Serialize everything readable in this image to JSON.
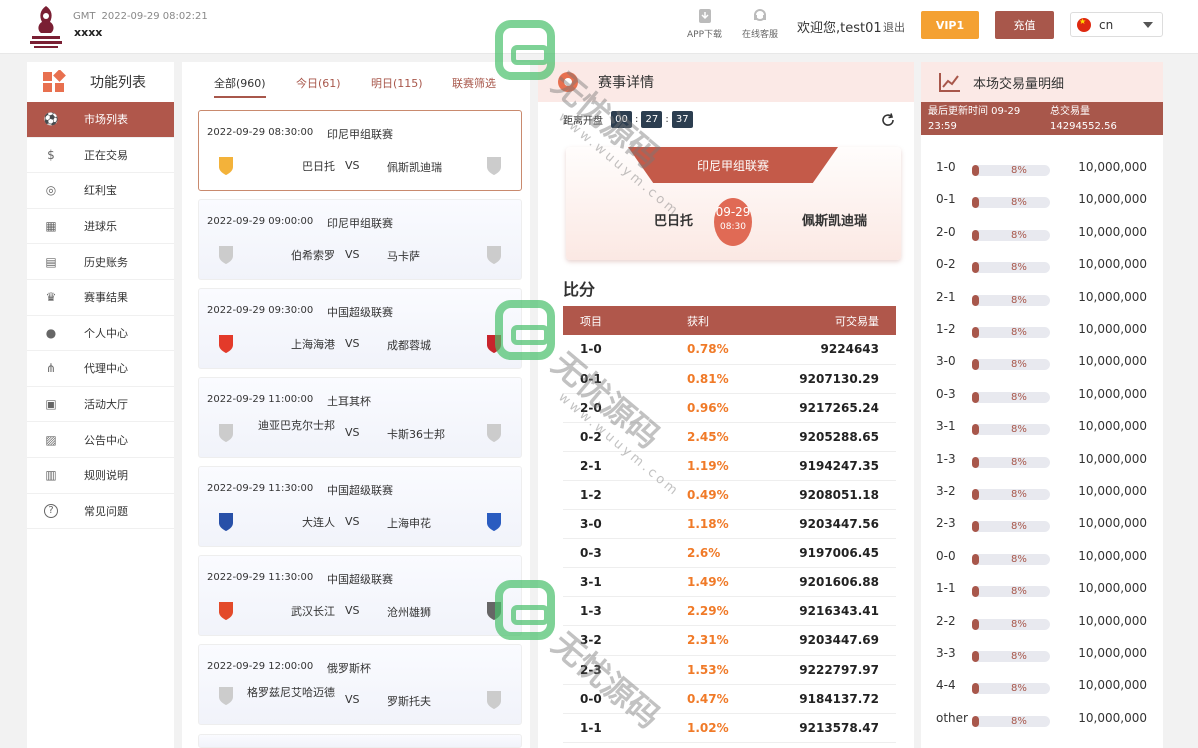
{
  "header": {
    "logo_text": "FIFA WORLD CUP Qatar 2022",
    "gmt_label": "GMT",
    "datetime": "2022-09-29 08:02:21",
    "username": "xxxx",
    "app_download": "APP下载",
    "online_service": "在线客服",
    "welcome": "欢迎您,test01",
    "logout": "退出",
    "vip": "VIP1",
    "recharge": "充值",
    "language": "cn"
  },
  "sidebar": {
    "title": "功能列表",
    "items": [
      {
        "label": "市场列表",
        "icon": "soccer-ball-icon"
      },
      {
        "label": "正在交易",
        "icon": "dollar-icon"
      },
      {
        "label": "红利宝",
        "icon": "coins-icon"
      },
      {
        "label": "进球乐",
        "icon": "goal-icon"
      },
      {
        "label": "历史账务",
        "icon": "ledger-icon"
      },
      {
        "label": "赛事结果",
        "icon": "trophy-icon"
      },
      {
        "label": "个人中心",
        "icon": "user-icon"
      },
      {
        "label": "代理中心",
        "icon": "hierarchy-icon"
      },
      {
        "label": "活动大厅",
        "icon": "gift-icon"
      },
      {
        "label": "公告中心",
        "icon": "image-icon"
      },
      {
        "label": "规则说明",
        "icon": "save-icon"
      },
      {
        "label": "常见问题",
        "icon": "question-icon"
      }
    ]
  },
  "matches": {
    "tabs": [
      "全部(960)",
      "今日(61)",
      "明日(115)",
      "联赛筛选"
    ],
    "list": [
      {
        "time": "2022-09-29 08:30:00",
        "league": "印尼甲组联赛",
        "home": "巴日托",
        "vs": "VS",
        "away": "佩斯凯迪瑞"
      },
      {
        "time": "2022-09-29 09:00:00",
        "league": "印尼甲组联赛",
        "home": "伯希索罗",
        "vs": "VS",
        "away": "马卡萨"
      },
      {
        "time": "2022-09-29 09:30:00",
        "league": "中国超级联赛",
        "home": "上海海港",
        "vs": "VS",
        "away": "成都蓉城"
      },
      {
        "time": "2022-09-29 11:00:00",
        "league": "土耳其杯",
        "home": "迪亚巴克尔士邦",
        "vs": "VS",
        "away": "卡斯36士邦"
      },
      {
        "time": "2022-09-29 11:30:00",
        "league": "中国超级联赛",
        "home": "大连人",
        "vs": "VS",
        "away": "上海申花"
      },
      {
        "time": "2022-09-29 11:30:00",
        "league": "中国超级联赛",
        "home": "武汉长江",
        "vs": "VS",
        "away": "沧州雄狮"
      },
      {
        "time": "2022-09-29 12:00:00",
        "league": "俄罗斯杯",
        "home": "格罗兹尼艾哈迈德",
        "vs": "VS",
        "away": "罗斯托夫"
      }
    ]
  },
  "detail": {
    "title": "赛事详情",
    "countdown_label": "距离开盘",
    "countdown": [
      "00",
      "27",
      "37"
    ],
    "league": "印尼甲组联赛",
    "home": "巴日托",
    "away": "佩斯凯迪瑞",
    "date": "09-29",
    "time": "08:30",
    "score_title": "比分",
    "table_headers": [
      "项目",
      "获利",
      "可交易量"
    ],
    "rows": [
      [
        "1-0",
        "0.78%",
        "9224643"
      ],
      [
        "0-1",
        "0.81%",
        "9207130.29"
      ],
      [
        "2-0",
        "0.96%",
        "9217265.24"
      ],
      [
        "0-2",
        "2.45%",
        "9205288.65"
      ],
      [
        "2-1",
        "1.19%",
        "9194247.35"
      ],
      [
        "1-2",
        "0.49%",
        "9208051.18"
      ],
      [
        "3-0",
        "1.18%",
        "9203447.56"
      ],
      [
        "0-3",
        "2.6%",
        "9197006.45"
      ],
      [
        "3-1",
        "1.49%",
        "9201606.88"
      ],
      [
        "1-3",
        "2.29%",
        "9216343.41"
      ],
      [
        "3-2",
        "2.31%",
        "9203447.69"
      ],
      [
        "2-3",
        "1.53%",
        "9222797.97"
      ],
      [
        "0-0",
        "0.47%",
        "9184137.72"
      ],
      [
        "1-1",
        "1.02%",
        "9213578.47"
      ]
    ]
  },
  "volume": {
    "title": "本场交易量明细",
    "last_update_label": "最后更新时间 09-29 23:59",
    "total_label": "总交易量",
    "total_value": "14294552.56",
    "rows": [
      {
        "score": "1-0",
        "pct": "8%",
        "fill": 0.08,
        "amount": "10,000,000"
      },
      {
        "score": "0-1",
        "pct": "8%",
        "fill": 0.08,
        "amount": "10,000,000"
      },
      {
        "score": "2-0",
        "pct": "8%",
        "fill": 0.08,
        "amount": "10,000,000"
      },
      {
        "score": "0-2",
        "pct": "8%",
        "fill": 0.08,
        "amount": "10,000,000"
      },
      {
        "score": "2-1",
        "pct": "8%",
        "fill": 0.08,
        "amount": "10,000,000"
      },
      {
        "score": "1-2",
        "pct": "8%",
        "fill": 0.08,
        "amount": "10,000,000"
      },
      {
        "score": "3-0",
        "pct": "8%",
        "fill": 0.08,
        "amount": "10,000,000"
      },
      {
        "score": "0-3",
        "pct": "8%",
        "fill": 0.08,
        "amount": "10,000,000"
      },
      {
        "score": "3-1",
        "pct": "8%",
        "fill": 0.08,
        "amount": "10,000,000"
      },
      {
        "score": "1-3",
        "pct": "8%",
        "fill": 0.08,
        "amount": "10,000,000"
      },
      {
        "score": "3-2",
        "pct": "8%",
        "fill": 0.08,
        "amount": "10,000,000"
      },
      {
        "score": "2-3",
        "pct": "8%",
        "fill": 0.08,
        "amount": "10,000,000"
      },
      {
        "score": "0-0",
        "pct": "8%",
        "fill": 0.08,
        "amount": "10,000,000"
      },
      {
        "score": "1-1",
        "pct": "8%",
        "fill": 0.08,
        "amount": "10,000,000"
      },
      {
        "score": "2-2",
        "pct": "8%",
        "fill": 0.08,
        "amount": "10,000,000"
      },
      {
        "score": "3-3",
        "pct": "8%",
        "fill": 0.08,
        "amount": "10,000,000"
      },
      {
        "score": "4-4",
        "pct": "8%",
        "fill": 0.08,
        "amount": "10,000,000"
      },
      {
        "score": "other",
        "pct": "8%",
        "fill": 0.08,
        "amount": "10,000,000"
      }
    ]
  },
  "watermark": {
    "text": "无忧源码",
    "url": "www.wuuym.com"
  },
  "colors": {
    "accent": "#a8574b",
    "vip": "#f4a132",
    "profit": "#f07a28"
  }
}
